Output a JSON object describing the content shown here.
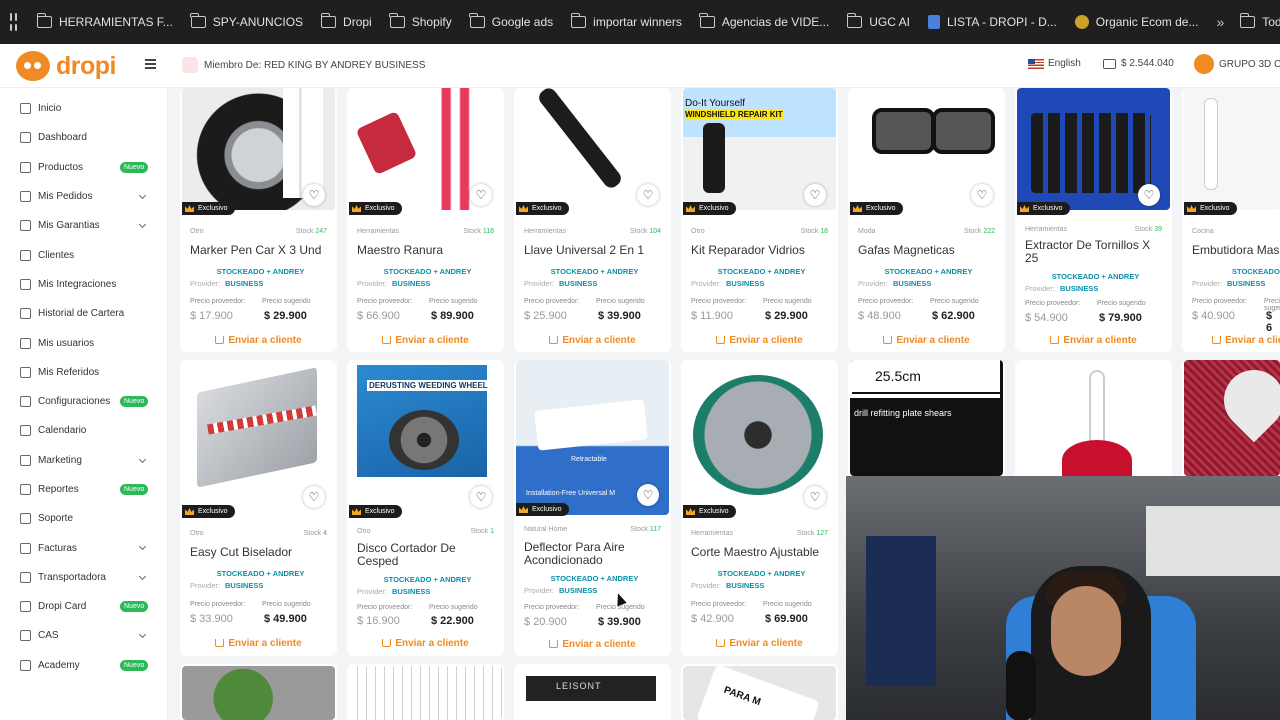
{
  "bookmarks": {
    "items": [
      {
        "label": "HERRAMIENTAS F...",
        "icon": "folder-icon"
      },
      {
        "label": "SPY-ANUNCIOS",
        "icon": "folder-icon"
      },
      {
        "label": "Dropi",
        "icon": "folder-icon"
      },
      {
        "label": "Shopify",
        "icon": "folder-icon"
      },
      {
        "label": "Google ads",
        "icon": "folder-icon"
      },
      {
        "label": "importar winners",
        "icon": "folder-icon"
      },
      {
        "label": "Agencias de VIDE...",
        "icon": "folder-icon"
      },
      {
        "label": "UGC AI",
        "icon": "folder-icon"
      },
      {
        "label": "LISTA - DROPI - D...",
        "icon": "doc-icon"
      },
      {
        "label": "Organic Ecom de...",
        "icon": "coin-icon"
      }
    ],
    "more": "»",
    "all_label": "Todos los"
  },
  "header": {
    "logo": "dropi",
    "member": "Miembro De: RED KING BY ANDREY BUSINESS",
    "language": "English",
    "balance": "$ 2.544.040",
    "group": "GRUPO 3D C"
  },
  "sidebar": {
    "items": [
      {
        "label": "Inicio",
        "icon": "home-icon"
      },
      {
        "label": "Dashboard",
        "icon": "dashboard-icon"
      },
      {
        "label": "Productos",
        "icon": "search-icon",
        "badge": "Nuevo"
      },
      {
        "label": "Mis Pedidos",
        "icon": "cart-icon",
        "chevron": true
      },
      {
        "label": "Mis Garantias",
        "icon": "check-icon",
        "chevron": true
      },
      {
        "label": "Clientes",
        "icon": "users-icon"
      },
      {
        "label": "Mis Integraciones",
        "icon": "integrations-icon"
      },
      {
        "label": "Historial de Cartera",
        "icon": "history-icon"
      },
      {
        "label": "Mis usuarios",
        "icon": "user-icon"
      },
      {
        "label": "Mis Referidos",
        "icon": "referrals-icon"
      },
      {
        "label": "Configuraciones",
        "icon": "gear-icon",
        "badge": "Nuevo"
      },
      {
        "label": "Calendario",
        "icon": "calendar-icon"
      },
      {
        "label": "Marketing",
        "icon": "megaphone-icon",
        "chevron": true
      },
      {
        "label": "Reportes",
        "icon": "report-icon",
        "badge": "Nuevo"
      },
      {
        "label": "Soporte",
        "icon": "support-icon"
      },
      {
        "label": "Facturas",
        "icon": "invoice-icon",
        "chevron": true
      },
      {
        "label": "Transportadora",
        "icon": "truck-icon",
        "chevron": true
      },
      {
        "label": "Dropi Card",
        "icon": "card-icon",
        "badge": "Nuevo"
      },
      {
        "label": "CAS",
        "icon": "cas-icon",
        "chevron": true
      },
      {
        "label": "Academy",
        "icon": "academy-icon",
        "badge": "Nuevo"
      }
    ]
  },
  "common": {
    "exclusive": "Exclusivo",
    "provider_label": "Provider:",
    "provider_name_1": "STOCKEADO + ANDREY",
    "provider_name_2": "BUSINESS",
    "price_provider_label": "Precio proveedor:",
    "price_suggested_label": "Precio sugerido",
    "send_label": "Enviar a cliente",
    "stock_label": "Stock"
  },
  "products_row1": [
    {
      "category": "Otro",
      "stock": "247",
      "title": "Marker Pen Car X 3 Und",
      "price_provider": "$ 17.900",
      "price_suggested": "$ 29.900",
      "image": "tire-marker"
    },
    {
      "category": "Herramientas",
      "stock": "118",
      "title": "Maestro Ranura",
      "price_provider": "$ 66.900",
      "price_suggested": "$ 89.900",
      "image": "groove-master"
    },
    {
      "category": "Herramientas",
      "stock": "104",
      "title": "Llave Universal 2 En 1",
      "price_provider": "$ 25.900",
      "price_suggested": "$ 39.900",
      "image": "wrench"
    },
    {
      "category": "Otro",
      "stock": "18",
      "title": "Kit Reparador Vidrios",
      "price_provider": "$ 11.900",
      "price_suggested": "$ 29.900",
      "image": "windshield-kit",
      "img_line1": "Do-It Yourself",
      "img_line2": "WINDSHIELD REPAIR KIT"
    },
    {
      "category": "Moda",
      "stock": "222",
      "title": "Gafas Magneticas",
      "price_provider": "$ 48.900",
      "price_suggested": "$ 62.900",
      "image": "glasses"
    },
    {
      "category": "Herramientas",
      "stock": "39",
      "title": "Extractor De Tornillos X 25",
      "price_provider": "$ 54.900",
      "price_suggested": "$ 79.900",
      "image": "screw-extractor"
    },
    {
      "category": "Cocina",
      "stock": "",
      "title": "Embutidora Mas",
      "price_provider": "$ 40.900",
      "price_suggested": "$ 6",
      "image": "sausage-stuffer"
    }
  ],
  "products_row2": [
    {
      "category": "Otro",
      "stock": "4",
      "title": "Easy Cut Biselador",
      "price_provider": "$ 33.900",
      "price_suggested": "$ 49.900",
      "image": "beveler",
      "exclusive": true
    },
    {
      "category": "Otro",
      "stock": "1",
      "title": "Disco Cortador De Cesped",
      "price_provider": "$ 16.900",
      "price_suggested": "$ 22.900",
      "image": "grass-disc",
      "exclusive": true,
      "img_text": "DERUSTING WEEDING WHEEL"
    },
    {
      "category": "Natural Home",
      "stock": "117",
      "title": "Deflector Para Aire Acondicionado",
      "price_provider": "$ 20.900",
      "price_suggested": "$ 39.900",
      "image": "ac-deflector",
      "exclusive": false,
      "img_text": "Retractable",
      "img_text2": "Installation-Free Universal M"
    },
    {
      "category": "Herramientas",
      "stock": "127",
      "title": "Corte Maestro Ajustable",
      "price_provider": "$ 42.900",
      "price_suggested": "$ 69.900",
      "image": "hole-cutter",
      "exclusive": true
    }
  ],
  "row2_extra": {
    "shear_measure": "25.5cm",
    "shear_text": "drill refitting plate shears"
  },
  "row3_images": {
    "belt_text": "LEISONT",
    "tag_text": "PARA M"
  }
}
